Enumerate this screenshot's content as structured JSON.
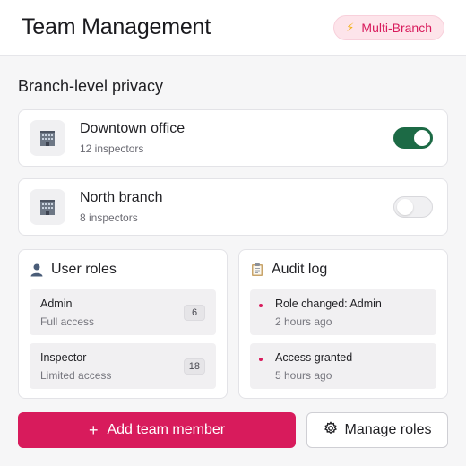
{
  "header": {
    "title": "Team Management",
    "badge": {
      "icon": "lightning-icon",
      "label": "Multi-Branch"
    }
  },
  "privacy": {
    "title": "Branch-level privacy",
    "branches": [
      {
        "icon": "building-icon",
        "name": "Downtown office",
        "sub": "12 inspectors",
        "enabled": true
      },
      {
        "icon": "building-icon",
        "name": "North branch",
        "sub": "8 inspectors",
        "enabled": false
      }
    ]
  },
  "roles": {
    "icon": "user-icon",
    "title": "User roles",
    "items": [
      {
        "name": "Admin",
        "desc": "Full access",
        "count": "6"
      },
      {
        "name": "Inspector",
        "desc": "Limited access",
        "count": "18"
      }
    ]
  },
  "audit": {
    "icon": "clipboard-icon",
    "title": "Audit log",
    "items": [
      {
        "event": "Role changed: Admin",
        "time": "2 hours ago"
      },
      {
        "event": "Access granted",
        "time": "5 hours ago"
      }
    ]
  },
  "actions": {
    "add_label": "Add team member",
    "manage_label": "Manage roles"
  },
  "colors": {
    "accent": "#d81b5c",
    "toggle_on": "#1c6a45",
    "badge_bg": "#fde4ea"
  }
}
